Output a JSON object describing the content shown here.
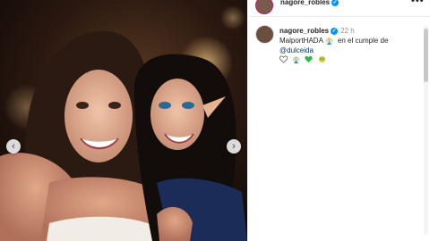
{
  "post": {
    "photo_alt": "",
    "prev_glyph": "‹",
    "next_glyph": "›"
  },
  "header": {
    "username": "nagore_robles",
    "verified_glyph": "✓",
    "more_glyph": "•••"
  },
  "caption": {
    "username": "nagore_robles",
    "verified_glyph": "✓",
    "time": "22 h",
    "text_part1": "MalportHADA",
    "text_part2": "en el cumple de",
    "mention": "@dulceida",
    "icons": [
      "white-heart-icon",
      "fairy-emoji-icon",
      "green-heart-icon",
      "crown-emoji-icon"
    ]
  },
  "colors": {
    "verified": "#0095f6",
    "mention": "#00376b",
    "text": "#262626",
    "muted": "#8e8e8e"
  }
}
